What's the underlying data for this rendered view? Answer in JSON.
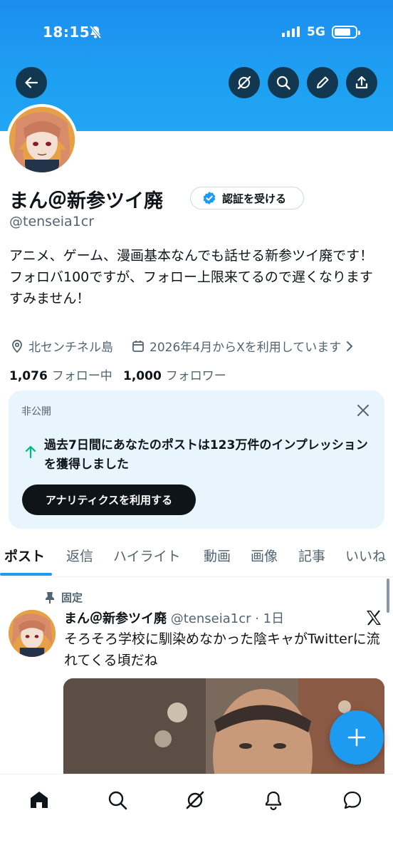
{
  "status_bar": {
    "time": "18:15",
    "network": "5G"
  },
  "colors": {
    "accent": "#1d9bf0",
    "banner": "#1d8df0",
    "dark": "#0f1419",
    "muted": "#536471",
    "card_bg": "#e8f5fd",
    "green": "#00ba7c"
  },
  "header_buttons": [
    "back-icon",
    "grok-icon",
    "search-icon",
    "edit-icon",
    "share-icon"
  ],
  "profile": {
    "display_name": "まん＠新参ツイ廃",
    "verify_button": "認証を受ける",
    "handle": "@tenseia1cr",
    "bio_line1": "アニメ、ゲーム、漫画基本なんでも話せる新参ツイ廃です！",
    "bio_line2": "フォロバ100ですが、フォロー上限来てるので遅くなりますすみません！",
    "location": "北センチネル島",
    "joined": "2026年4月からXを利用しています",
    "following_count": "1,076",
    "following_label": "フォロー中",
    "followers_count": "1,000",
    "followers_label": "フォロワー"
  },
  "analytics_card": {
    "label": "非公開",
    "message": "過去7日間にあなたのポストは123万件のインプレッションを獲得しました",
    "button": "アナリティクスを利用する"
  },
  "tabs": [
    "ポスト",
    "返信",
    "ハイライト",
    "動画",
    "画像",
    "記事",
    "いいね"
  ],
  "pinned_post": {
    "pin_label": "固定",
    "author": "まん＠新参ツイ廃",
    "meta": "@tenseia1cr · 1日",
    "text": "そろそろ学校に馴染めなかった陰キャがTwitterに流れてくる頃だね"
  },
  "bottom_nav": [
    "home-icon",
    "search-icon",
    "grok-icon",
    "notifications-icon",
    "messages-icon"
  ]
}
